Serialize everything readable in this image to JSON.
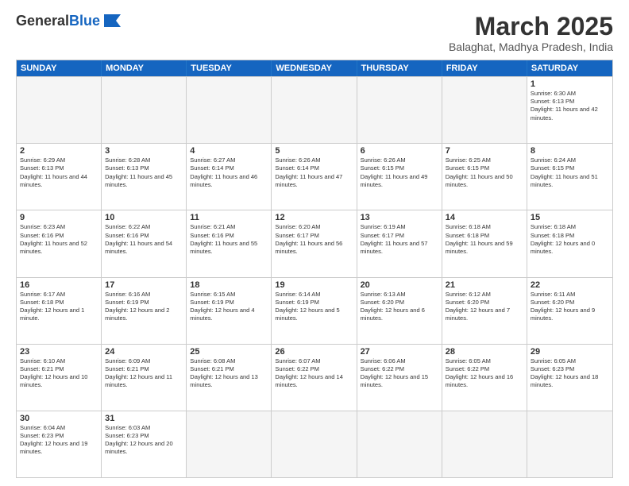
{
  "header": {
    "logo_general": "General",
    "logo_blue": "Blue",
    "month_title": "March 2025",
    "location": "Balaghat, Madhya Pradesh, India"
  },
  "weekdays": [
    "Sunday",
    "Monday",
    "Tuesday",
    "Wednesday",
    "Thursday",
    "Friday",
    "Saturday"
  ],
  "weeks": [
    [
      {
        "day": "",
        "info": ""
      },
      {
        "day": "",
        "info": ""
      },
      {
        "day": "",
        "info": ""
      },
      {
        "day": "",
        "info": ""
      },
      {
        "day": "",
        "info": ""
      },
      {
        "day": "",
        "info": ""
      },
      {
        "day": "1",
        "info": "Sunrise: 6:30 AM\nSunset: 6:13 PM\nDaylight: 11 hours and 42 minutes."
      }
    ],
    [
      {
        "day": "2",
        "info": "Sunrise: 6:29 AM\nSunset: 6:13 PM\nDaylight: 11 hours and 44 minutes."
      },
      {
        "day": "3",
        "info": "Sunrise: 6:28 AM\nSunset: 6:13 PM\nDaylight: 11 hours and 45 minutes."
      },
      {
        "day": "4",
        "info": "Sunrise: 6:27 AM\nSunset: 6:14 PM\nDaylight: 11 hours and 46 minutes."
      },
      {
        "day": "5",
        "info": "Sunrise: 6:26 AM\nSunset: 6:14 PM\nDaylight: 11 hours and 47 minutes."
      },
      {
        "day": "6",
        "info": "Sunrise: 6:26 AM\nSunset: 6:15 PM\nDaylight: 11 hours and 49 minutes."
      },
      {
        "day": "7",
        "info": "Sunrise: 6:25 AM\nSunset: 6:15 PM\nDaylight: 11 hours and 50 minutes."
      },
      {
        "day": "8",
        "info": "Sunrise: 6:24 AM\nSunset: 6:15 PM\nDaylight: 11 hours and 51 minutes."
      }
    ],
    [
      {
        "day": "9",
        "info": "Sunrise: 6:23 AM\nSunset: 6:16 PM\nDaylight: 11 hours and 52 minutes."
      },
      {
        "day": "10",
        "info": "Sunrise: 6:22 AM\nSunset: 6:16 PM\nDaylight: 11 hours and 54 minutes."
      },
      {
        "day": "11",
        "info": "Sunrise: 6:21 AM\nSunset: 6:16 PM\nDaylight: 11 hours and 55 minutes."
      },
      {
        "day": "12",
        "info": "Sunrise: 6:20 AM\nSunset: 6:17 PM\nDaylight: 11 hours and 56 minutes."
      },
      {
        "day": "13",
        "info": "Sunrise: 6:19 AM\nSunset: 6:17 PM\nDaylight: 11 hours and 57 minutes."
      },
      {
        "day": "14",
        "info": "Sunrise: 6:18 AM\nSunset: 6:18 PM\nDaylight: 11 hours and 59 minutes."
      },
      {
        "day": "15",
        "info": "Sunrise: 6:18 AM\nSunset: 6:18 PM\nDaylight: 12 hours and 0 minutes."
      }
    ],
    [
      {
        "day": "16",
        "info": "Sunrise: 6:17 AM\nSunset: 6:18 PM\nDaylight: 12 hours and 1 minute."
      },
      {
        "day": "17",
        "info": "Sunrise: 6:16 AM\nSunset: 6:19 PM\nDaylight: 12 hours and 2 minutes."
      },
      {
        "day": "18",
        "info": "Sunrise: 6:15 AM\nSunset: 6:19 PM\nDaylight: 12 hours and 4 minutes."
      },
      {
        "day": "19",
        "info": "Sunrise: 6:14 AM\nSunset: 6:19 PM\nDaylight: 12 hours and 5 minutes."
      },
      {
        "day": "20",
        "info": "Sunrise: 6:13 AM\nSunset: 6:20 PM\nDaylight: 12 hours and 6 minutes."
      },
      {
        "day": "21",
        "info": "Sunrise: 6:12 AM\nSunset: 6:20 PM\nDaylight: 12 hours and 7 minutes."
      },
      {
        "day": "22",
        "info": "Sunrise: 6:11 AM\nSunset: 6:20 PM\nDaylight: 12 hours and 9 minutes."
      }
    ],
    [
      {
        "day": "23",
        "info": "Sunrise: 6:10 AM\nSunset: 6:21 PM\nDaylight: 12 hours and 10 minutes."
      },
      {
        "day": "24",
        "info": "Sunrise: 6:09 AM\nSunset: 6:21 PM\nDaylight: 12 hours and 11 minutes."
      },
      {
        "day": "25",
        "info": "Sunrise: 6:08 AM\nSunset: 6:21 PM\nDaylight: 12 hours and 13 minutes."
      },
      {
        "day": "26",
        "info": "Sunrise: 6:07 AM\nSunset: 6:22 PM\nDaylight: 12 hours and 14 minutes."
      },
      {
        "day": "27",
        "info": "Sunrise: 6:06 AM\nSunset: 6:22 PM\nDaylight: 12 hours and 15 minutes."
      },
      {
        "day": "28",
        "info": "Sunrise: 6:05 AM\nSunset: 6:22 PM\nDaylight: 12 hours and 16 minutes."
      },
      {
        "day": "29",
        "info": "Sunrise: 6:05 AM\nSunset: 6:23 PM\nDaylight: 12 hours and 18 minutes."
      }
    ],
    [
      {
        "day": "30",
        "info": "Sunrise: 6:04 AM\nSunset: 6:23 PM\nDaylight: 12 hours and 19 minutes."
      },
      {
        "day": "31",
        "info": "Sunrise: 6:03 AM\nSunset: 6:23 PM\nDaylight: 12 hours and 20 minutes."
      },
      {
        "day": "",
        "info": ""
      },
      {
        "day": "",
        "info": ""
      },
      {
        "day": "",
        "info": ""
      },
      {
        "day": "",
        "info": ""
      },
      {
        "day": "",
        "info": ""
      }
    ]
  ]
}
